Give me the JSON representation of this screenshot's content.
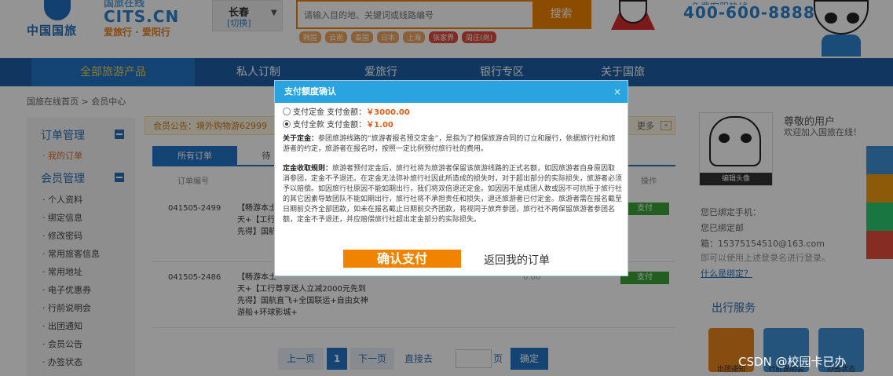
{
  "header": {
    "logo_text": "中国国旅",
    "brand_top": "国旅在线",
    "brand_url": "CITS.CN",
    "brand_slogan": "爱旅行 · 爱阳行",
    "city_name": "长春",
    "city_switch": "[切换]",
    "search_placeholder": "请输入目的地、关键词或线路编号",
    "search_button": "搜索",
    "hot_tags": [
      "韩国",
      "云南",
      "泰国",
      "日本",
      "上海",
      "张家界",
      "周庄(尚)"
    ],
    "hotline_label": "免费客服热线",
    "hotline": "400-600-8888"
  },
  "nav": {
    "items": [
      "全部旅游产品",
      "私人订制",
      "爱旅行",
      "银行专区",
      "关于国旅"
    ]
  },
  "breadcrumb": "国旅在线首页 > 会员中心",
  "sidebar": {
    "orders_title": "订单管理",
    "orders_items": [
      "· 我的订单"
    ],
    "member_title": "会员管理",
    "member_items": [
      "· 个人资料",
      "· 绑定信息",
      "· 修改密码",
      "· 常用旅客信息",
      "· 常用地址",
      "· 电子优惠券",
      "· 行前说明会",
      "· 出团通知",
      "· 会员公告",
      "· 办签状态"
    ]
  },
  "notice": {
    "text": "会员公告：境外购物游62999",
    "more": "更多"
  },
  "tabs": [
    "所有订单",
    "待"
  ],
  "table": {
    "headers": [
      "订单编号",
      "操作"
    ],
    "rows": [
      {
        "number": "041505-2499",
        "title_lines": [
          "【畅游本土",
          "天+【工行",
          "先得】国航"
        ],
        "action": "支付"
      },
      {
        "number": "041505-2486",
        "title_lines": [
          "【畅游本土",
          "天+【工行尊享送人立减2000元先到",
          "先得】国航直飞+全国联运+自由女神",
          "游船+环球影城+"
        ],
        "extra": "0.00",
        "action": "支付"
      }
    ]
  },
  "pager": {
    "prev": "上一页",
    "current": "1",
    "next": "下一页",
    "goto": "直接去",
    "page_unit": "页",
    "ok": "确定"
  },
  "right": {
    "greeting": "尊敬的用户",
    "welcome": "欢迎加入国旅在线！",
    "avatar_caption": "编辑头像",
    "phone_label": "您已绑定手机：",
    "email_label": "您已绑定邮",
    "email": "箱：15375154510@163.com",
    "login_tip": "即可以使用上述登录名进行登录。",
    "what_bind": "什么是绑定？",
    "service_title": "出行服务",
    "services": [
      "出团通知",
      "行前说明会",
      "办签状态"
    ]
  },
  "modal": {
    "title": "支付额度确认",
    "close": "×",
    "option1_label": "支付定金 支付金额：",
    "option1_amount": "￥3000.00",
    "option2_label": "支付全款 支付金额：",
    "option2_amount": "￥1.00",
    "deposit_heading": "关于定金：",
    "deposit_text": "参团旅游线路的“旅游者报名预交定金”，是指为了担保旅游合同的订立和履行，依据旅行社和旅游者的约定，旅游者在报名时，按照一定比例预付旅行社的费用。",
    "refund_heading": "定金收取规则：",
    "refund_text": "旅游者预付定金后，旅行社将为旅游者保留该旅游线路的正式名额，如因旅游者自身原因取消参团，定金不予退还。在定金无法弥补旅行社因此所造成的损失时，对于超出部分的实际损失，旅游者必须予以赔偿。如因旅行社原因不能如期出行，我们将双倍退还定金。如因因不是成团人数或因不可抗拒于旅行社的其它因素导致团队不能如期出行，旅行社将不承担责任和损失，退还旅游者已付定金。旅游者需在报名截至日期前交齐全部团款，如未在报名截止日期前交齐团款，将视同于放弃参团，旅行社不再保留旅游者参团名额，定金不予退还，并应赔偿旅行社超出定金部分的实际损失。",
    "confirm_button": "确认支付",
    "back_link": "返回我的订单"
  },
  "watermark": "CSDN @校园卡已办",
  "colors": {
    "nav_bg": "#1e5fa8",
    "accent_orange": "#f08300",
    "modal_header": "#2aa4e0",
    "amount_red": "#e35d13"
  }
}
